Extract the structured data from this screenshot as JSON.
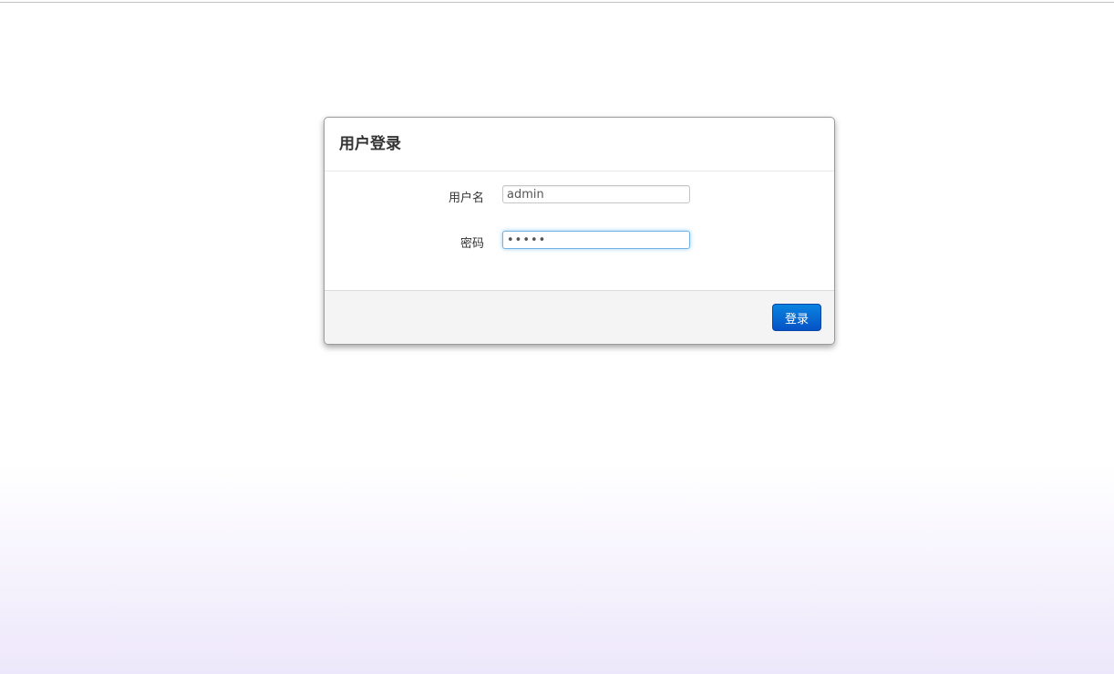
{
  "login_dialog": {
    "title": "用户登录",
    "username": {
      "label": "用户名",
      "value": "admin"
    },
    "password": {
      "label": "密码",
      "value": "•••••"
    },
    "submit_label": "登录"
  },
  "colors": {
    "button_primary": "#0552c6",
    "focus_border": "#72b3e6",
    "footer_background": "#f4f4f4",
    "page_gradient_bottom": "#ede7fb"
  }
}
